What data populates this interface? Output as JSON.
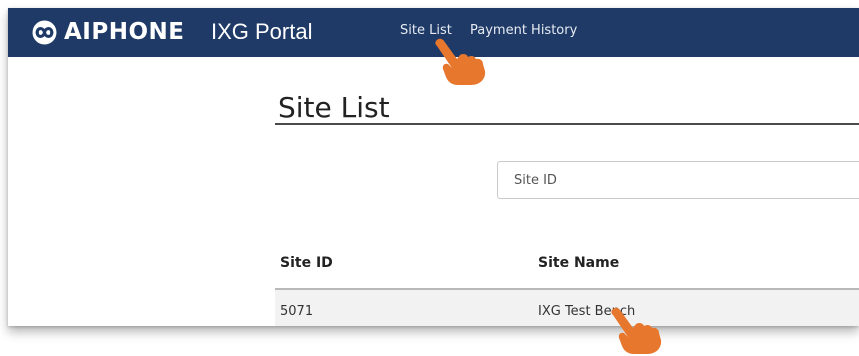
{
  "header": {
    "brand": "AIPHONE",
    "app_name": "IXG Portal",
    "nav": {
      "site_list": "Site List",
      "payment_history": "Payment History"
    },
    "colors": {
      "navbar_bg": "#1f3a66"
    }
  },
  "page": {
    "title": "Site List"
  },
  "search": {
    "placeholder": "Site ID",
    "value": ""
  },
  "table": {
    "columns": [
      "Site ID",
      "Site Name"
    ],
    "rows": [
      {
        "site_id": "5071",
        "site_name": "IXG Test Bench"
      }
    ]
  },
  "annotations": {
    "pointer_icon": "pointing-hand-icon",
    "pointer_color": "#e8772e"
  }
}
